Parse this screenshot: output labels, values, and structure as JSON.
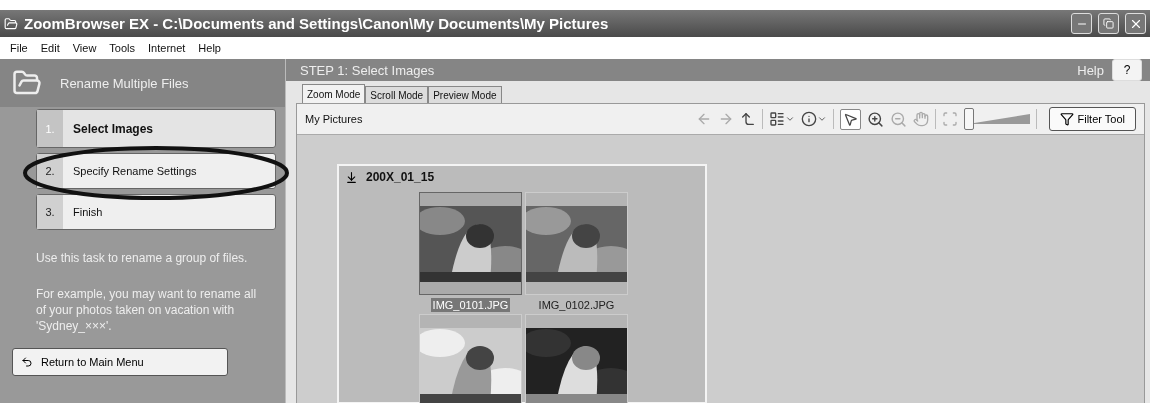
{
  "window": {
    "title": "ZoomBrowser EX  -  C:\\Documents and Settings\\Canon\\My Documents\\My Pictures"
  },
  "menu": [
    "File",
    "Edit",
    "View",
    "Tools",
    "Internet",
    "Help"
  ],
  "header": {
    "task_title": "Rename Multiple Files",
    "step_title": "STEP 1: Select Images",
    "help_label": "Help",
    "help_button": "?"
  },
  "steps": [
    {
      "number": "1.",
      "label": "Select Images",
      "selected": true
    },
    {
      "number": "2.",
      "label": "Specify Rename Settings",
      "selected": false
    },
    {
      "number": "3.",
      "label": "Finish",
      "selected": false
    }
  ],
  "description": [
    "Use this task to rename a group of files.",
    "For example, you may want to rename all of your photos taken on vacation with 'Sydney_×××'."
  ],
  "return_button": "Return to Main Menu",
  "tabs": [
    {
      "label": "Zoom Mode",
      "selected": true
    },
    {
      "label": "Scroll Mode",
      "selected": false
    },
    {
      "label": "Preview Mode",
      "selected": false
    }
  ],
  "location": "My Pictures",
  "zoom_slider": {
    "level": 0
  },
  "filter_button": "Filter Tool",
  "folder": {
    "name": "200X_01_15"
  },
  "thumbnails": [
    {
      "name": "IMG_0101.JPG",
      "selected": true
    },
    {
      "name": "IMG_0102.JPG",
      "selected": false
    },
    {
      "selected": false
    },
    {
      "selected": false
    }
  ]
}
